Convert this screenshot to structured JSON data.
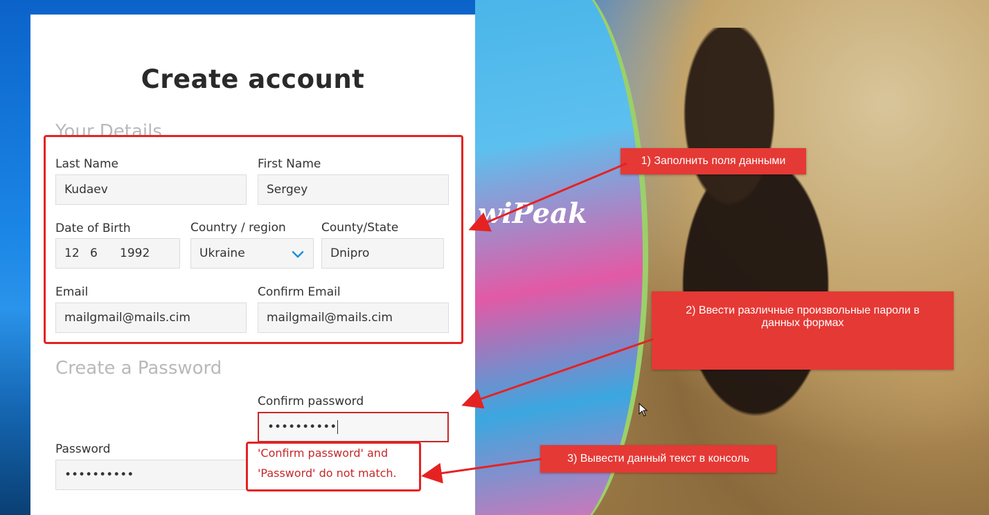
{
  "form": {
    "title": "Create account",
    "details_section": "Your Details",
    "last_name_label": "Last Name",
    "last_name_value": "Kudaev",
    "first_name_label": "First Name",
    "first_name_value": "Sergey",
    "dob_label": "Date of Birth",
    "dob_day": "12",
    "dob_month": "6",
    "dob_year": "1992",
    "country_label": "Country / region",
    "country_value": "Ukraine",
    "county_label": "County/State",
    "county_value": "Dnipro",
    "email_label": "Email",
    "email_value": "mailgmail@mails.cim",
    "confirm_email_label": "Confirm Email",
    "confirm_email_value": "mailgmail@mails.cim",
    "password_section": "Create a Password",
    "confirm_password_label": "Confirm password",
    "confirm_password_value": "••••••••••",
    "password_label": "Password",
    "password_value": "••••••••••",
    "error_line1": "'Confirm password' and",
    "error_line2": "'Password' do not match."
  },
  "annotations": {
    "note1": "1) Заполнить поля данными",
    "note2": "2) Ввести различные произвольные пароли в данных формах",
    "note3": "3) Вывести данный текст в консоль"
  },
  "background": {
    "board_text": "wiPeak"
  },
  "colors": {
    "annotation_red": "#e53935",
    "error_red": "#c62828",
    "chevron_blue": "#1a8fd6"
  },
  "icons": {
    "country_dropdown": "chevron-down-icon",
    "cursor": "mouse-pointer-icon"
  }
}
